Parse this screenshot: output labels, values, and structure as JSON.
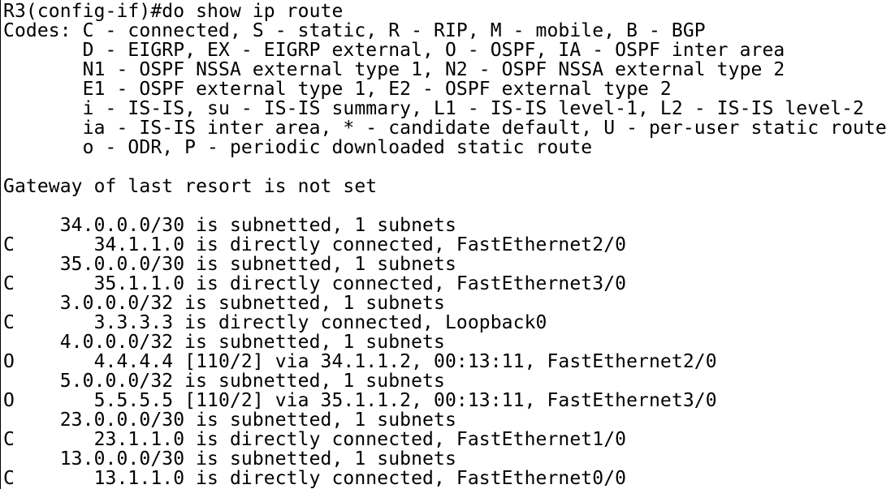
{
  "terminal": {
    "lines": [
      "R3(config-if)#do show ip route",
      "Codes: C - connected, S - static, R - RIP, M - mobile, B - BGP",
      "       D - EIGRP, EX - EIGRP external, O - OSPF, IA - OSPF inter area",
      "       N1 - OSPF NSSA external type 1, N2 - OSPF NSSA external type 2",
      "       E1 - OSPF external type 1, E2 - OSPF external type 2",
      "       i - IS-IS, su - IS-IS summary, L1 - IS-IS level-1, L2 - IS-IS level-2",
      "       ia - IS-IS inter area, * - candidate default, U - per-user static route",
      "       o - ODR, P - periodic downloaded static route",
      "",
      "Gateway of last resort is not set",
      "",
      "     34.0.0.0/30 is subnetted, 1 subnets",
      "C       34.1.1.0 is directly connected, FastEthernet2/0",
      "     35.0.0.0/30 is subnetted, 1 subnets",
      "C       35.1.1.0 is directly connected, FastEthernet3/0",
      "     3.0.0.0/32 is subnetted, 1 subnets",
      "C       3.3.3.3 is directly connected, Loopback0",
      "     4.0.0.0/32 is subnetted, 1 subnets",
      "O       4.4.4.4 [110/2] via 34.1.1.2, 00:13:11, FastEthernet2/0",
      "     5.0.0.0/32 is subnetted, 1 subnets",
      "O       5.5.5.5 [110/2] via 35.1.1.2, 00:13:11, FastEthernet3/0",
      "     23.0.0.0/30 is subnetted, 1 subnets",
      "C       23.1.1.0 is directly connected, FastEthernet1/0",
      "     13.0.0.0/30 is subnetted, 1 subnets",
      "C       13.1.1.0 is directly connected, FastEthernet0/0"
    ]
  }
}
